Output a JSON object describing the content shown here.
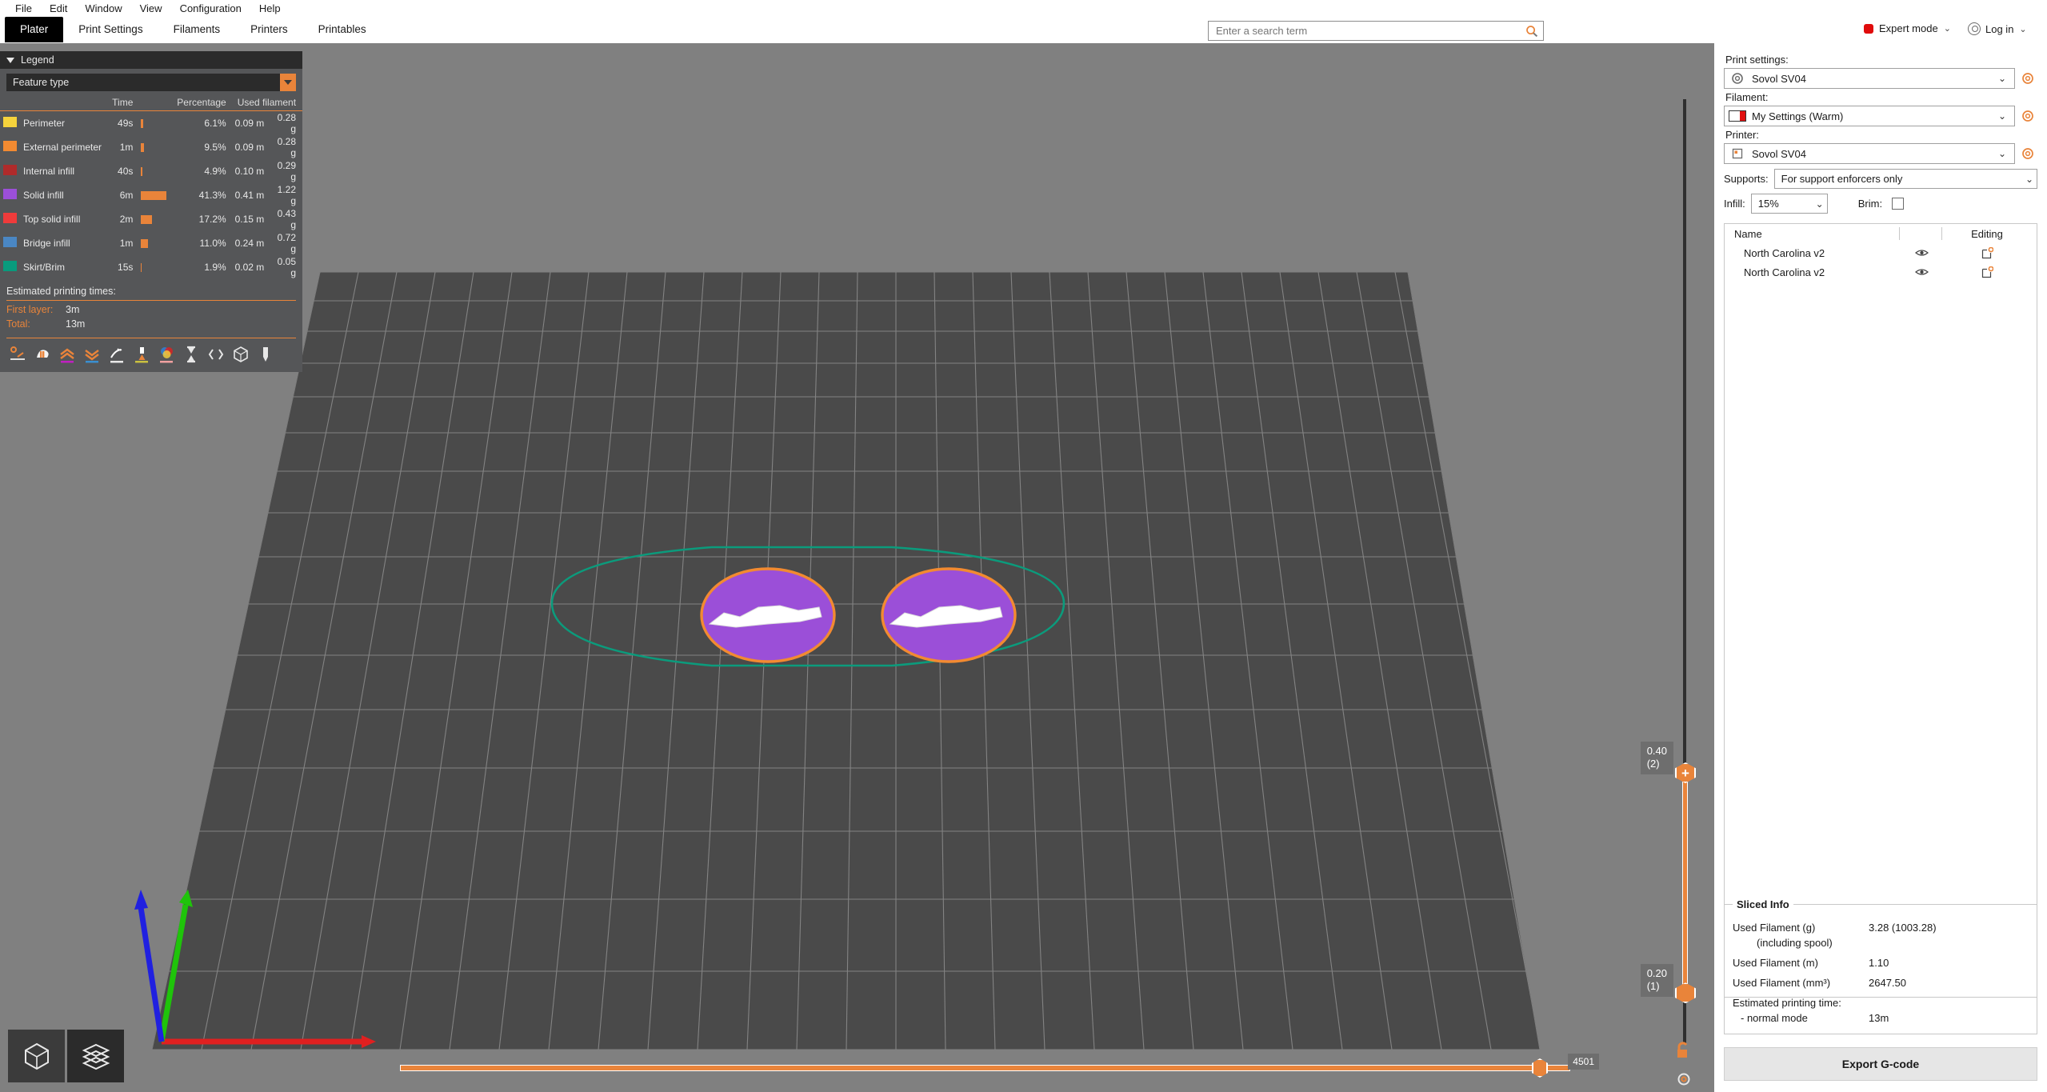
{
  "menubar": {
    "items": [
      "File",
      "Edit",
      "Window",
      "View",
      "Configuration",
      "Help"
    ]
  },
  "tabs": [
    {
      "label": "Plater",
      "active": true
    },
    {
      "label": "Print Settings",
      "active": false
    },
    {
      "label": "Filaments",
      "active": false
    },
    {
      "label": "Printers",
      "active": false
    },
    {
      "label": "Printables",
      "active": false
    }
  ],
  "search": {
    "placeholder": "Enter a search term",
    "value": "",
    "icon": "search-icon"
  },
  "mode": {
    "label": "Expert mode",
    "color": "#e00b0b",
    "chevron": "⌄"
  },
  "account": {
    "label": "Log in",
    "chevron": "⌄"
  },
  "legend": {
    "title": "Legend",
    "view_type": "Feature type",
    "columns": {
      "feature": "",
      "time": "Time",
      "percentage": "Percentage",
      "used_filament": "Used filament"
    },
    "rows": [
      {
        "color": "#f6d33c",
        "label": "Perimeter",
        "time": "49s",
        "percent": "6.1%",
        "percent_num": 6.1,
        "meters": "0.09 m",
        "grams": "0.28 g"
      },
      {
        "color": "#f28a31",
        "label": "External perimeter",
        "time": "1m",
        "percent": "9.5%",
        "percent_num": 9.5,
        "meters": "0.09 m",
        "grams": "0.28 g"
      },
      {
        "color": "#b02b2b",
        "label": "Internal infill",
        "time": "40s",
        "percent": "4.9%",
        "percent_num": 4.9,
        "meters": "0.10 m",
        "grams": "0.29 g"
      },
      {
        "color": "#a martin",
        "label": "",
        "time": "",
        "percent": "",
        "percent_num": 0,
        "meters": "",
        "grams": ""
      },
      {
        "color": "#9b4fd8",
        "label": "Solid infill",
        "time": "6m",
        "percent": "41.3%",
        "percent_num": 41.3,
        "meters": "0.41 m",
        "grams": "1.22 g"
      },
      {
        "color": "#ef3b3b",
        "label": "Top solid infill",
        "time": "2m",
        "percent": "17.2%",
        "percent_num": 17.2,
        "meters": "0.15 m",
        "grams": "0.43 g"
      },
      {
        "color": "#4a87c4",
        "label": "Bridge infill",
        "time": "1m",
        "percent": "11.0%",
        "percent_num": 11.0,
        "meters": "0.24 m",
        "grams": "0.72 g"
      },
      {
        "color": "#089b7d",
        "label": "Skirt/Brim",
        "time": "15s",
        "percent": "1.9%",
        "percent_num": 1.9,
        "meters": "0.02 m",
        "grams": "0.05 g"
      }
    ],
    "est_title": "Estimated printing times:",
    "first_layer_key": "First layer:",
    "first_layer_value": "3m",
    "total_key": "Total:",
    "total_value": "13m",
    "tools": [
      "travel-paths-icon",
      "retractions-icon",
      "seams-icon",
      "deretractions-icon",
      "wipe-icon",
      "tool-changes-icon",
      "color-changes-icon",
      "pause-prints-icon",
      "custom-gcode-icon",
      "shells-icon",
      "tool-marker-icon"
    ]
  },
  "vertical_slider": {
    "top_label_value": "0.40",
    "top_label_layer": "(2)",
    "bottom_label_value": "0.20",
    "bottom_label_layer": "(1)",
    "lock_icon": "unlocked-icon",
    "gear_icon": "gear-icon"
  },
  "horizontal_slider": {
    "value": "4501",
    "position_pct": 97
  },
  "view_toggles": [
    {
      "name": "editor-view-toggle",
      "icon": "cube-icon",
      "selected": false
    },
    {
      "name": "preview-view-toggle",
      "icon": "layers-icon",
      "selected": true
    }
  ],
  "sidebar": {
    "print_settings_label": "Print settings:",
    "print_settings_value": "Sovol SV04",
    "filament_label": "Filament:",
    "filament_value": "My Settings (Warm)",
    "printer_label": "Printer:",
    "printer_value": "Sovol SV04",
    "supports_label": "Supports:",
    "supports_value": "For support enforcers only",
    "infill_label": "Infill:",
    "infill_value": "15%",
    "brim_label": "Brim:",
    "brim_checked": false,
    "object_list": {
      "col_name": "Name",
      "col_editing": "Editing",
      "rows": [
        {
          "name": "North Carolina v2",
          "eye": "eye-icon",
          "edit": "editing-icon"
        },
        {
          "name": "North Carolina v2",
          "eye": "eye-icon",
          "edit": "editing-icon"
        }
      ]
    },
    "sliced_info": {
      "title": "Sliced Info",
      "rows": [
        {
          "key": "Used Filament (g)",
          "sub": "(including spool)",
          "value": "3.28 (1003.28)"
        },
        {
          "key": "Used Filament (m)",
          "sub": "",
          "value": "1.10"
        },
        {
          "key": "Used Filament (mm³)",
          "sub": "",
          "value": "2647.50"
        },
        {
          "key": "Estimated printing time:",
          "sub": "- normal mode",
          "value": "13m"
        }
      ]
    },
    "export_button": "Export G-code"
  },
  "scene": {
    "bed_color": "#4a4a4a",
    "grid_color": "#8c8c8c",
    "skirt_color": "#089b7d",
    "solid_infill_color": "#9b4fd8",
    "perimeter_color": "#f28a31",
    "axis_x_color": "#e02020",
    "axis_y_color": "#1fc40a",
    "axis_z_color": "#2020e0"
  }
}
